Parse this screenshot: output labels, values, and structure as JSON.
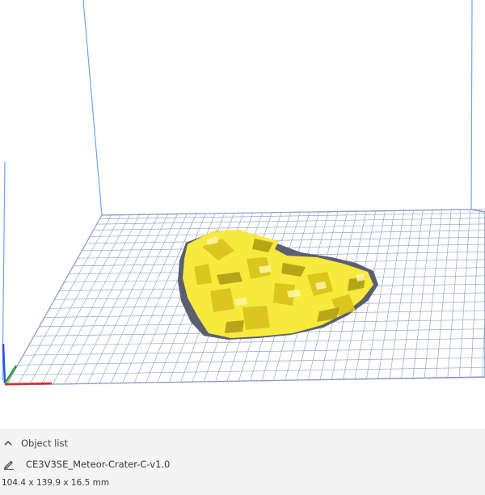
{
  "viewport": {
    "bed_color": "#ffffff",
    "grid_color": "#9aa7c4",
    "frame_color": "#6fa4e6",
    "model_color": "#f7ea3c",
    "model_shadow_color": "#5a5f73",
    "axis_colors": {
      "x": "#d92a2a",
      "y": "#2a9c3a",
      "z": "#2a55d9"
    }
  },
  "object_list": {
    "header_label": "Object list",
    "header_icon": "chevron-up-icon",
    "edit_icon": "pencil-icon",
    "object_name": "CE3V3SE_Meteor-Crater-C-v1.0",
    "dimensions": "104.4 x 139.9 x 16.5 mm"
  }
}
